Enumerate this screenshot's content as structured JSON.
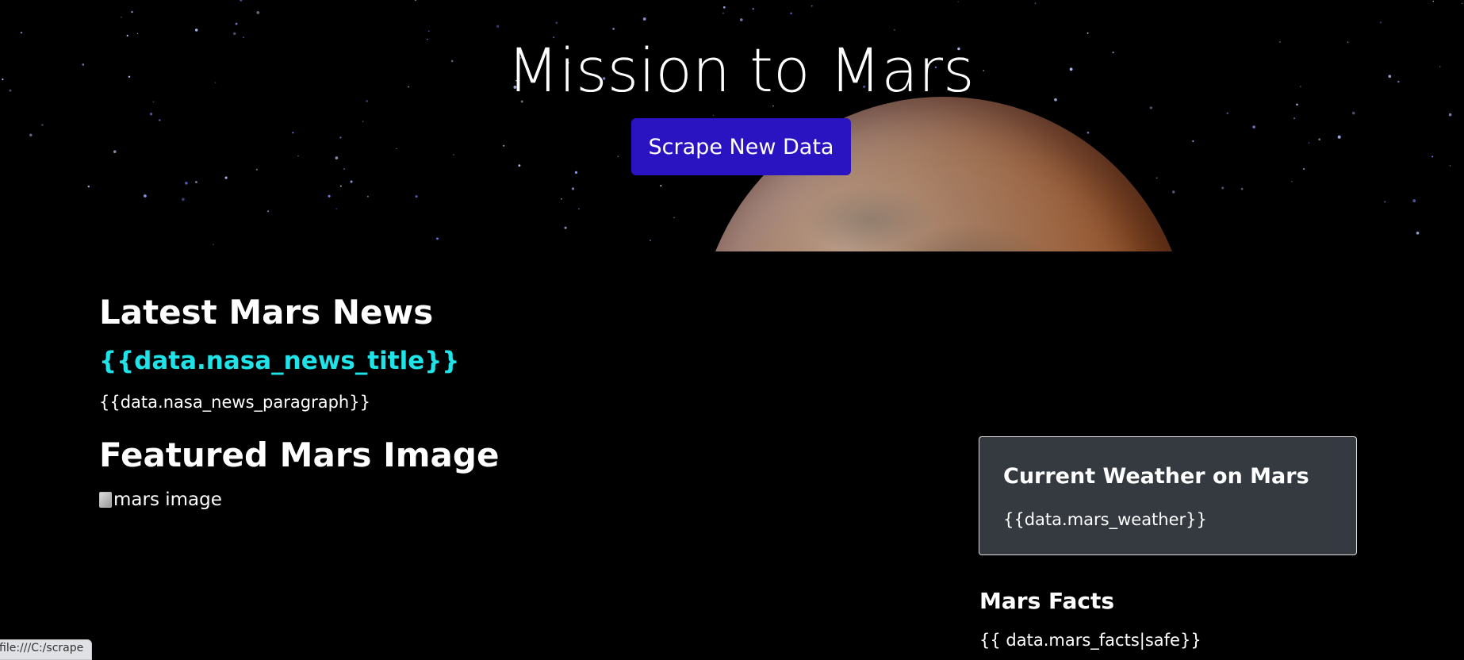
{
  "hero": {
    "title": "Mission to Mars",
    "scrape_button_label": "Scrape New Data"
  },
  "news": {
    "heading": "Latest Mars News",
    "title": "{{data.nasa_news_title}}",
    "paragraph": "{{data.nasa_news_paragraph}}"
  },
  "featured_image": {
    "heading": "Featured Mars Image",
    "alt_text": "mars image"
  },
  "weather": {
    "heading": "Current Weather on Mars",
    "text": "{{data.mars_weather}}"
  },
  "facts": {
    "heading": "Mars Facts",
    "text": "{{ data.mars_facts|safe}}"
  },
  "status_bar": {
    "url": "file:///C:/scrape"
  },
  "colors": {
    "background": "#000000",
    "button": "#2a14c2",
    "news_title": "#1ee3e9",
    "card": "#343a40"
  },
  "icons": {
    "broken_image": "broken-image-icon"
  }
}
